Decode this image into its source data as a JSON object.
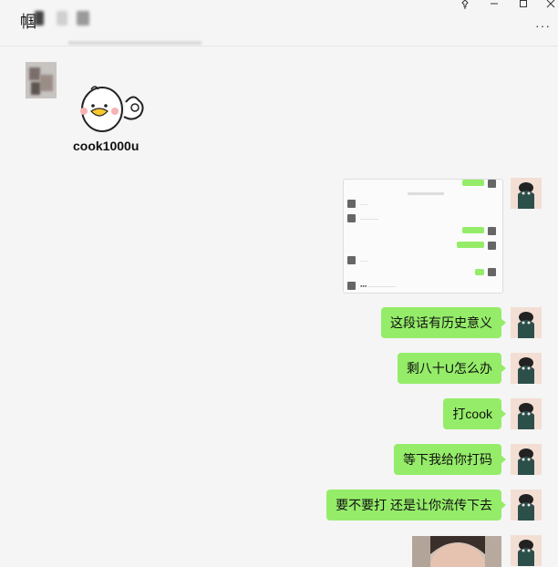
{
  "window": {
    "title": "帼",
    "controls": [
      "pin-icon",
      "minimize-icon",
      "maximize-icon",
      "close-icon"
    ],
    "more_label": "···"
  },
  "sticker": {
    "caption": "cook1000u",
    "icon": "duck-ok-sticker"
  },
  "messages": [
    {
      "text": "这段话有历史意义",
      "sender": "me"
    },
    {
      "text": "剩八十U怎么办",
      "sender": "me"
    },
    {
      "text": "打cook",
      "sender": "me"
    },
    {
      "text": "等下我给你打码",
      "sender": "me"
    },
    {
      "text": "要不要打  还是让你流传下去",
      "sender": "me"
    }
  ],
  "colors": {
    "bubble_me": "#95ec69",
    "background": "#f5f5f5"
  }
}
